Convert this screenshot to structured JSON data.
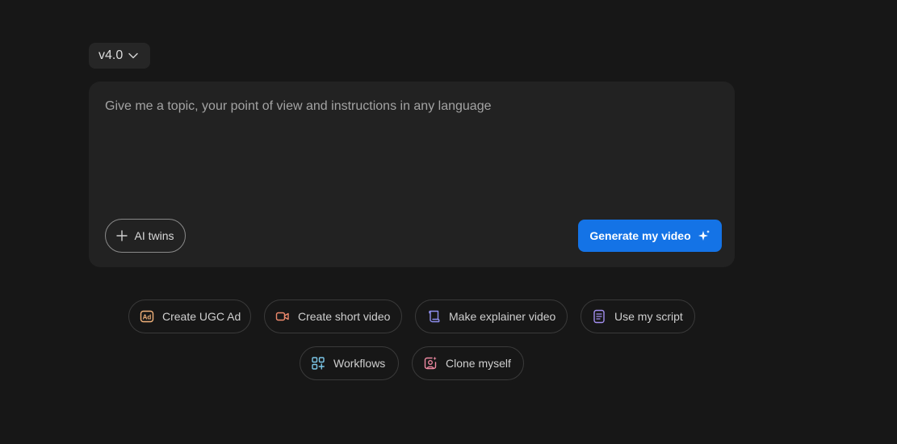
{
  "version": {
    "label": "v4.0"
  },
  "prompt": {
    "placeholder": "Give me a topic, your point of view and instructions in any language",
    "value": ""
  },
  "ai_twins_label": "AI twins",
  "generate_label": "Generate my video",
  "colors": {
    "background": "#171717",
    "card": "#222222",
    "primary_button": "#1473e6"
  },
  "suggestions": [
    {
      "label": "Create UGC Ad",
      "icon": "ad-icon",
      "color": "#f2b27a"
    },
    {
      "label": "Create short video",
      "icon": "video-camera-icon",
      "color": "#ef8a6d"
    },
    {
      "label": "Make explainer video",
      "icon": "scroll-icon",
      "color": "#8f8ff0"
    },
    {
      "label": "Use my script",
      "icon": "document-icon",
      "color": "#a38ff0"
    },
    {
      "label": "Workflows",
      "icon": "workflow-icon",
      "color": "#7cc7e8"
    },
    {
      "label": "Clone myself",
      "icon": "user-sparkle-icon",
      "color": "#f08aa3"
    }
  ]
}
